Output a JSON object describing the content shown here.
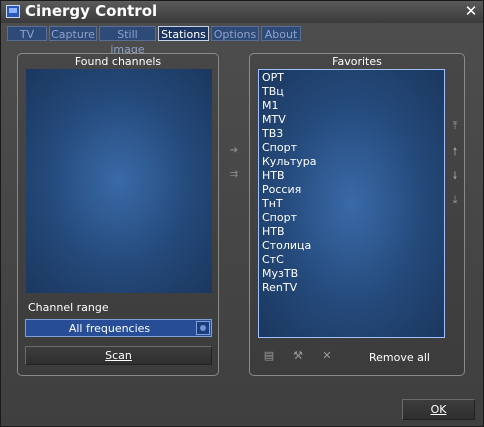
{
  "window": {
    "title": "Cinergy Control",
    "close_glyph": "✕"
  },
  "tabs": [
    {
      "label": "TV",
      "active": false
    },
    {
      "label": "Capture",
      "active": false
    },
    {
      "label": "Still image",
      "active": false
    },
    {
      "label": "Stations",
      "active": true
    },
    {
      "label": "Options",
      "active": false
    },
    {
      "label": "About",
      "active": false
    }
  ],
  "found_channels": {
    "title": "Found channels",
    "channel_range_label": "Channel range",
    "range_value": "All frequencies",
    "scan_label": "Scan"
  },
  "transfer": {
    "add_icon": "arrow-right-icon",
    "add_all_icon": "double-arrow-right-icon"
  },
  "favorites": {
    "title": "Favorites",
    "items": [
      "ОРТ",
      "ТВц",
      "М1",
      "MTV",
      "ТВ3",
      "Спорт",
      "Культура",
      "НТВ",
      "Россия",
      "ТнТ",
      "Спорт",
      "НТВ",
      "Столица",
      "СтС",
      "МузТВ",
      "RenTV"
    ],
    "remove_all_label": "Remove all"
  },
  "ok_label": "OK",
  "colors": {
    "accent": "#2a58b8",
    "list_bg": "#24497a",
    "list_border": "#9ec0ff"
  }
}
